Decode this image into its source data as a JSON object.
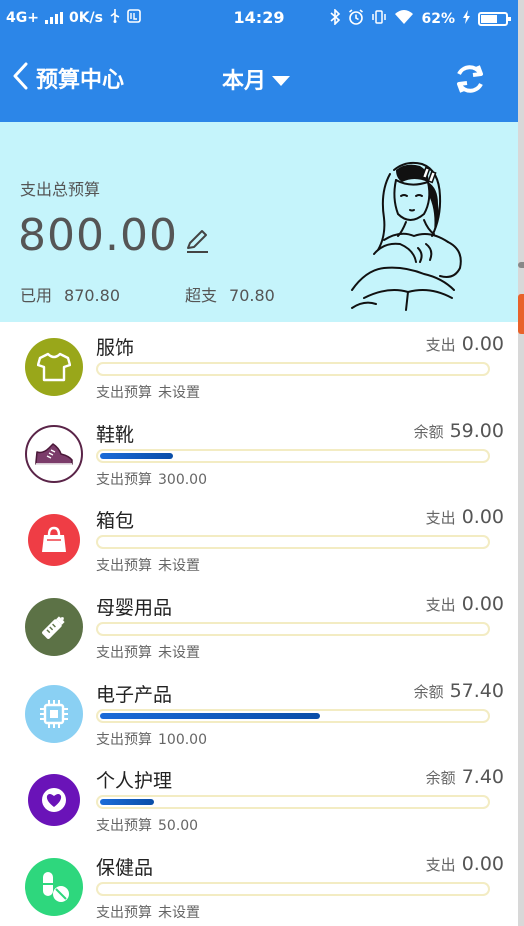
{
  "status_bar": {
    "network": "4G+",
    "speed": "0K/s",
    "time": "14:29",
    "battery": "62%"
  },
  "header": {
    "back_label": "预算中心",
    "period_label": "本月"
  },
  "summary": {
    "title": "支出总预算",
    "amount": "800.00",
    "used_label": "已用",
    "used_value": "870.80",
    "over_label": "超支",
    "over_value": "70.80"
  },
  "budget_label": "支出预算",
  "categories": [
    {
      "name": "服饰",
      "right_label": "支出",
      "right_value": "0.00",
      "budget": "未设置",
      "progress": 0,
      "icon": "shirt-icon",
      "color": "#99a71a"
    },
    {
      "name": "鞋靴",
      "right_label": "余额",
      "right_value": "59.00",
      "budget": "300.00",
      "progress": 0.19,
      "icon": "sneaker-icon",
      "color": "#ffffff"
    },
    {
      "name": "箱包",
      "right_label": "支出",
      "right_value": "0.00",
      "budget": "未设置",
      "progress": 0,
      "icon": "bag-icon",
      "color": "#ef3d45"
    },
    {
      "name": "母婴用品",
      "right_label": "支出",
      "right_value": "0.00",
      "budget": "未设置",
      "progress": 0,
      "icon": "baby-bottle-icon",
      "color": "#5c7246"
    },
    {
      "name": "电子产品",
      "right_label": "余额",
      "right_value": "57.40",
      "budget": "100.00",
      "progress": 0.57,
      "icon": "chip-icon",
      "color": "#8ad0f3"
    },
    {
      "name": "个人护理",
      "right_label": "余额",
      "right_value": "7.40",
      "budget": "50.00",
      "progress": 0.14,
      "icon": "heart-icon",
      "color": "#6a13b8"
    },
    {
      "name": "保健品",
      "right_label": "支出",
      "right_value": "0.00",
      "budget": "未设置",
      "progress": 0,
      "icon": "pill-icon",
      "color": "#2ed77d"
    }
  ]
}
